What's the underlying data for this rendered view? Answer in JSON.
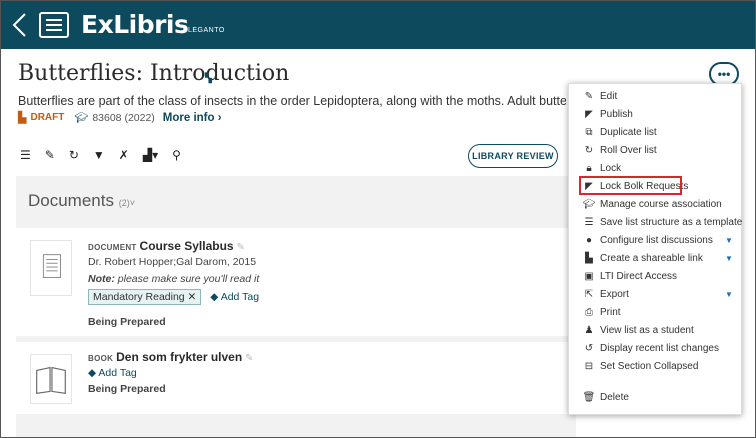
{
  "header": {
    "logo": "ExLibris",
    "product": "LEGANTO"
  },
  "list": {
    "title": "Butterflies: Introduction",
    "description": "Butterflies are part of the class of insects in the order Lepidoptera, along with the moths. Adult butterflies h",
    "status": "DRAFT",
    "course": "83608 (2022)",
    "more_info": "More info ›"
  },
  "toolbar": {
    "library_review": "LIBRARY REVIEW"
  },
  "section": {
    "title": "Documents",
    "count": "(2)˅"
  },
  "items": [
    {
      "type": "DOCUMENT",
      "title": "Course Syllabus",
      "author": "Dr. Robert Hopper;Gal Darom, 2015",
      "note_label": "Note:",
      "note": "please make sure you'll read it",
      "tag": "Mandatory Reading ✕",
      "add_tag": "Add Tag",
      "status": "Being Prepared"
    },
    {
      "type": "BOOK",
      "title": "Den som frykter ulven",
      "add_tag": "Add Tag",
      "status": "Being Prepared"
    }
  ],
  "menu": {
    "button": "•••",
    "items": [
      {
        "label": "Edit",
        "icon": "pencil-icon"
      },
      {
        "label": "Publish",
        "icon": "paper-plane-icon"
      },
      {
        "label": "Duplicate list",
        "icon": "duplicate-icon"
      },
      {
        "label": "Roll Over list",
        "icon": "rollover-icon"
      },
      {
        "label": "Lock",
        "icon": "lock-icon"
      },
      {
        "label": "Lock Bolk Requests",
        "icon": "paper-plane-icon"
      },
      {
        "label": "Manage course association",
        "icon": "graduation-cap-icon"
      },
      {
        "label": "Save list structure as a template",
        "icon": "list-icon"
      },
      {
        "label": "Configure list discussions",
        "icon": "discussion-icon"
      },
      {
        "label": "Create a shareable link",
        "icon": "share-link-icon"
      },
      {
        "label": "LTI Direct Access",
        "icon": "lti-icon"
      },
      {
        "label": "Export",
        "icon": "export-icon"
      },
      {
        "label": "Print",
        "icon": "print-icon"
      },
      {
        "label": "View list as a student",
        "icon": "student-icon"
      },
      {
        "label": "Display recent list changes",
        "icon": "history-icon"
      },
      {
        "label": "Set Section Collapsed",
        "icon": "collapse-icon"
      },
      {
        "label": "Delete",
        "icon": "trash-icon"
      }
    ]
  },
  "colors": {
    "brand": "#0d4a5e",
    "draft": "#c55a11",
    "highlight": "#d9262c",
    "caret": "#1e6fb8"
  }
}
